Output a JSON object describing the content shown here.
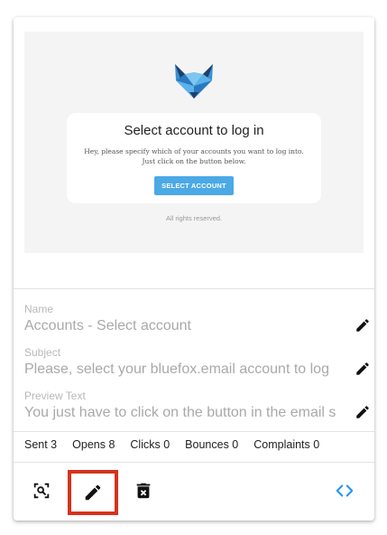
{
  "preview": {
    "title": "Select account to log in",
    "body": "Hey, please specify which of your accounts you want to log into. Just click on the button below.",
    "button_label": "SELECT ACCOUNT",
    "footer": "All rights reserved.",
    "logo_icon": "bluefox-logo-icon",
    "accent_color": "#4ba9e6"
  },
  "fields": {
    "name_label": "Name",
    "name_value": "Accounts - Select account",
    "subject_label": "Subject",
    "subject_value": "Please, select your bluefox.email account to log",
    "preview_label": "Preview Text",
    "preview_value": "You just have to click on the button in the email s"
  },
  "stats": {
    "sent": "Sent 3",
    "opens": "Opens 8",
    "clicks": "Clicks 0",
    "bounces": "Bounces 0",
    "complaints": "Complaints 0"
  },
  "actions": {
    "preview_icon": "zoom-preview-icon",
    "edit_icon": "pencil-icon",
    "delete_icon": "trash-icon",
    "code_icon": "code-icon",
    "highlight_color": "#d6321c",
    "code_color": "#2196f3"
  }
}
